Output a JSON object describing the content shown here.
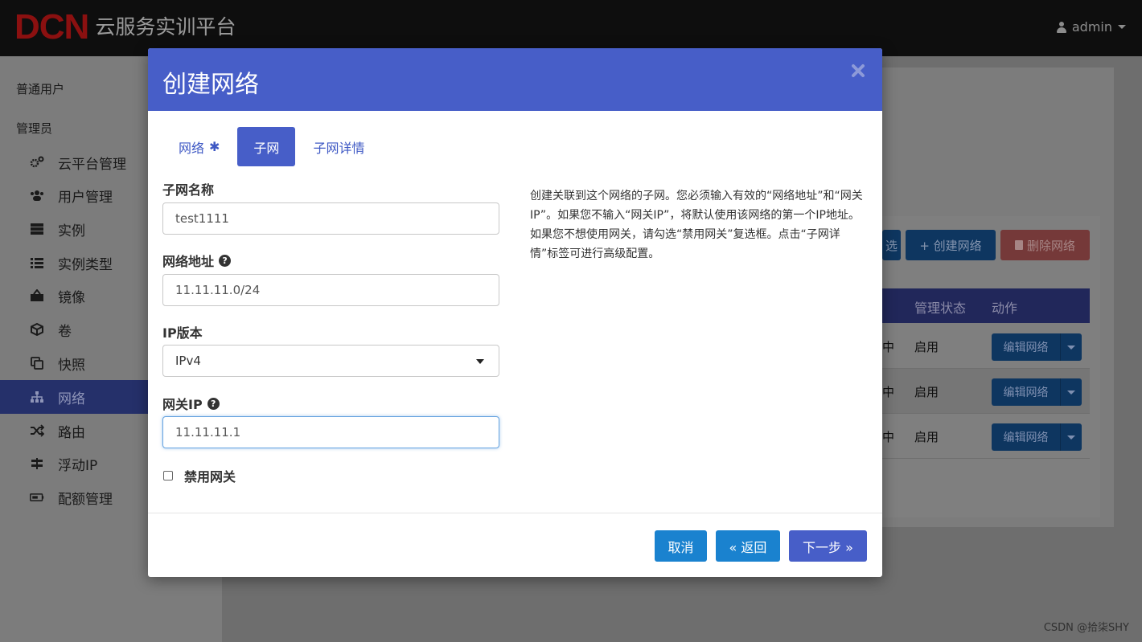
{
  "header": {
    "logo_mark": "DCN",
    "title": "云服务实训平台",
    "user": "admin"
  },
  "sidebar": {
    "section_user": "普通用户",
    "section_admin": "管理员",
    "items": [
      {
        "label": "云平台管理",
        "icon": "cogs-icon"
      },
      {
        "label": "用户管理",
        "icon": "users-icon"
      },
      {
        "label": "实例",
        "icon": "server-icon"
      },
      {
        "label": "实例类型",
        "icon": "list-icon"
      },
      {
        "label": "镜像",
        "icon": "image-icon"
      },
      {
        "label": "卷",
        "icon": "cube-icon"
      },
      {
        "label": "快照",
        "icon": "copy-icon"
      },
      {
        "label": "网络",
        "icon": "sitemap-icon",
        "active": true
      },
      {
        "label": "路由",
        "icon": "random-icon"
      },
      {
        "label": "浮动IP",
        "icon": "signpost-icon"
      },
      {
        "label": "配额管理",
        "icon": "battery-icon"
      }
    ]
  },
  "background_page": {
    "filter_btn_partial": "选",
    "create_network_btn": "+ 创建网络",
    "delete_network_btn": "删除网络",
    "table_headers": {
      "admin_state": "管理状态",
      "actions": "动作"
    },
    "rows": [
      {
        "status_partial": "中",
        "admin_state": "启用",
        "action": "编辑网络"
      },
      {
        "status_partial": "中",
        "admin_state": "启用",
        "action": "编辑网络"
      },
      {
        "status_partial": "中",
        "admin_state": "启用",
        "action": "编辑网络"
      }
    ]
  },
  "modal": {
    "title": "创建网络",
    "tabs": [
      {
        "label": "网络",
        "required_mark": "✱"
      },
      {
        "label": "子网",
        "active": true
      },
      {
        "label": "子网详情"
      }
    ],
    "fields": {
      "subnet_name": {
        "label": "子网名称",
        "value": "test1111"
      },
      "network_address": {
        "label": "网络地址",
        "value": "11.11.11.0/24"
      },
      "ip_version": {
        "label": "IP版本",
        "value": "IPv4"
      },
      "gateway_ip": {
        "label": "网关IP",
        "value": "11.11.11.1"
      },
      "disable_gateway": {
        "label": "禁用网关",
        "checked": false
      }
    },
    "help_text": "创建关联到这个网络的子网。您必须输入有效的“网络地址”和“网关IP”。如果您不输入“网关IP”，将默认使用该网络的第一个IP地址。如果您不想使用网关，请勾选“禁用网关”复选框。点击“子网详情”标签可进行高级配置。",
    "buttons": {
      "cancel": "取消",
      "back": "« 返回",
      "next": "下一步 »"
    }
  },
  "watermark": "CSDN @拾柒SHY",
  "colors": {
    "modal_header": "#475ec8",
    "button_blue": "#1a82cf",
    "active_tab": "#475ec8"
  }
}
